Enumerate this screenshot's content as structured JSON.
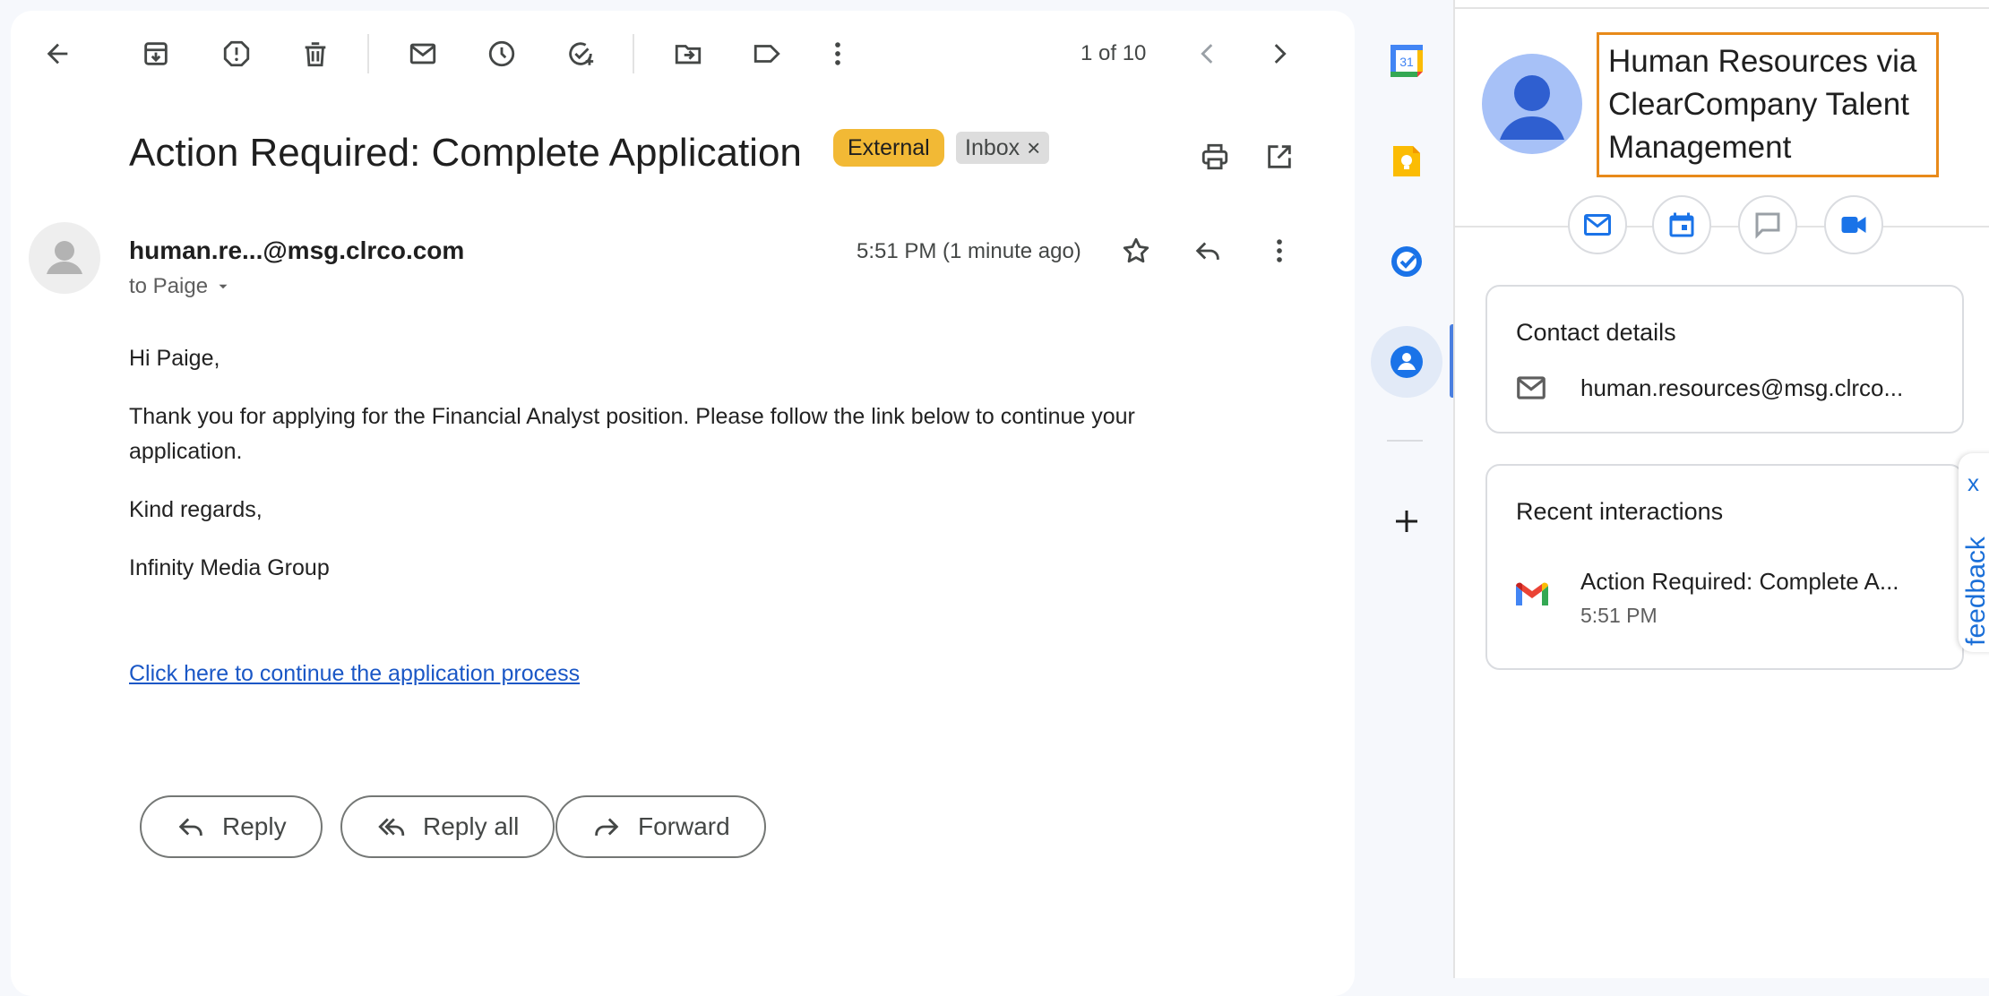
{
  "toolbar": {
    "back_icon": "arrow-left-icon",
    "archive_icon": "archive-icon",
    "report_spam_icon": "report-icon",
    "delete_icon": "trash-icon",
    "mark_unread_icon": "mail-icon",
    "snooze_icon": "clock-icon",
    "add_task_icon": "add-task-icon",
    "move_to_icon": "move-to-icon",
    "labels_icon": "label-icon",
    "more_icon": "more-vert-icon",
    "pager_text": "1 of 10"
  },
  "email": {
    "subject": "Action Required: Complete Application",
    "chips": {
      "external": "External",
      "inbox": "Inbox",
      "inbox_remove": "×"
    },
    "sender": "human.re...@msg.clrco.com",
    "to": "to Paige",
    "time": "5:51 PM (1 minute ago)",
    "body": {
      "greeting": "Hi Paige,",
      "paragraph": "Thank you for applying for the Financial Analyst position. Please follow the link below to continue your application.",
      "closing": "Kind regards,",
      "signature": "Infinity Media Group"
    },
    "link_text": "Click here to continue the application process",
    "actions": {
      "reply": "Reply",
      "reply_all": "Reply all",
      "forward": "Forward"
    }
  },
  "side_strip": {
    "calendar_day": "31",
    "icons": [
      "calendar-icon",
      "keep-icon",
      "tasks-icon",
      "contacts-icon",
      "add-icon"
    ]
  },
  "contact_panel": {
    "name": "Human Resources via ClearCompany Talent Management",
    "contact_details_title": "Contact details",
    "email": "human.resources@msg.clrco...",
    "recent_title": "Recent interactions",
    "recent_subject": "Action Required: Complete A...",
    "recent_time": "5:51 PM"
  },
  "feedback": {
    "label": "feedback",
    "close": "x"
  },
  "colors": {
    "accent_blue": "#1a73e8",
    "external_chip": "#f2b935",
    "highlight_border": "#e88a1a",
    "link": "#1a57c6"
  }
}
